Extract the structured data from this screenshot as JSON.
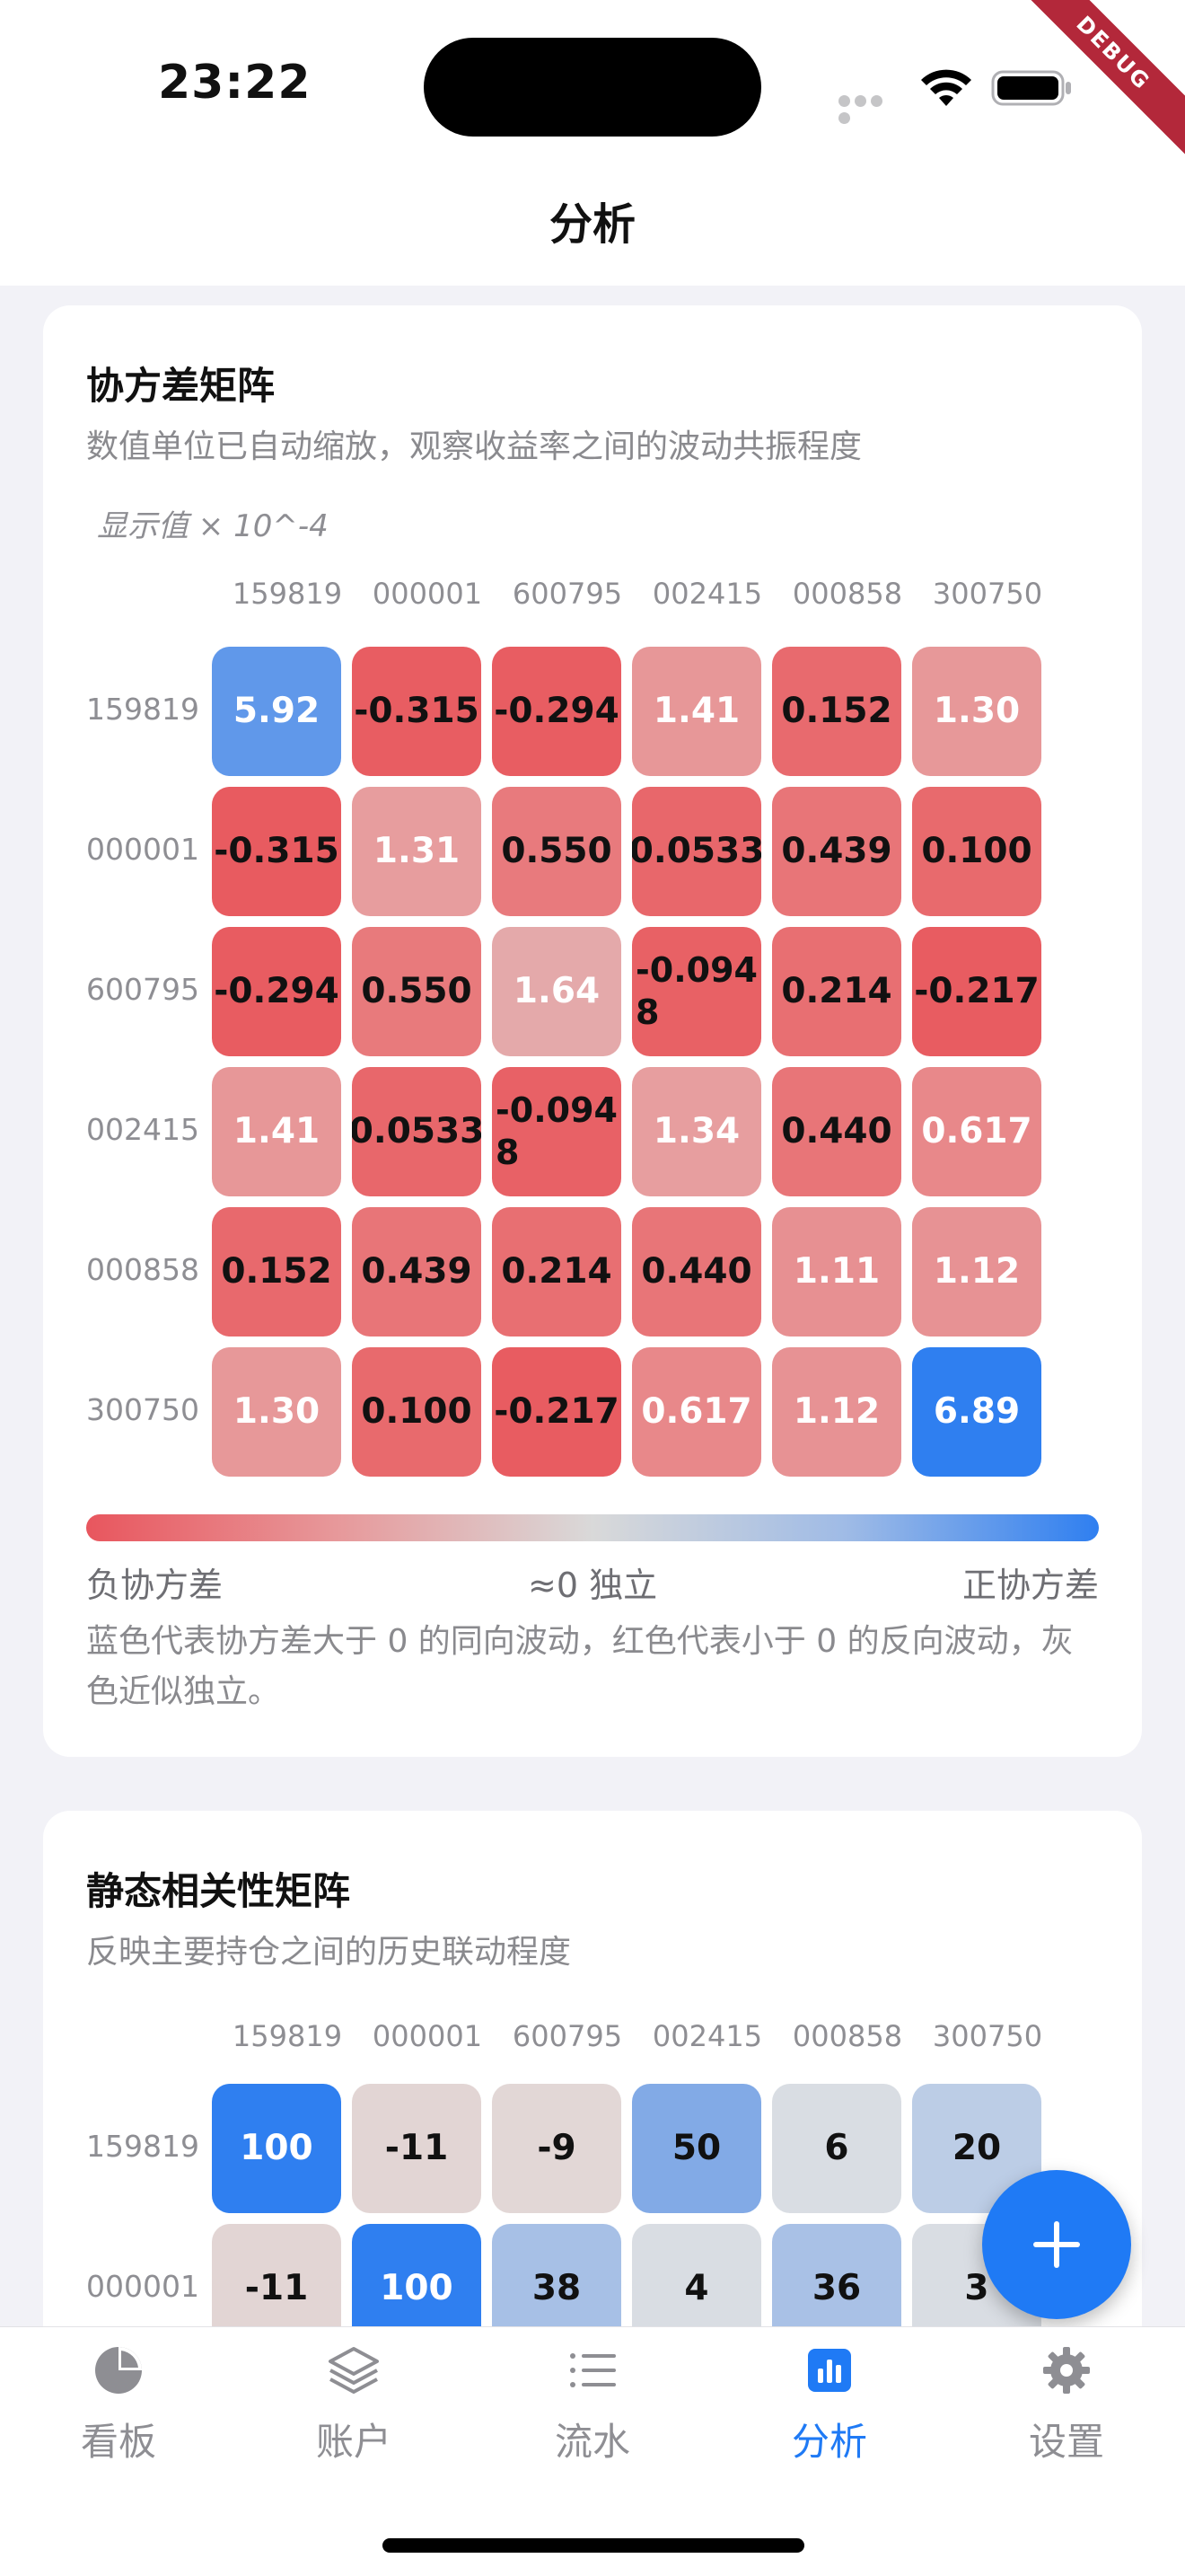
{
  "status_bar": {
    "time": "23:22",
    "debug_label": "DEBUG"
  },
  "nav": {
    "title": "分析"
  },
  "covariance_card": {
    "title": "协方差矩阵",
    "subtitle": "数值单位已自动缩放，观察收益率之间的波动共振程度",
    "scale_note": "显示值 × 10^-4",
    "tickers": [
      "159819",
      "000001",
      "600795",
      "002415",
      "000858",
      "300750"
    ],
    "cells": [
      [
        "5.92",
        "-0.315",
        "-0.294",
        "1.41",
        "0.152",
        "1.30"
      ],
      [
        "-0.315",
        "1.31",
        "0.550",
        "0.0533",
        "0.439",
        "0.100"
      ],
      [
        "-0.294",
        "0.550",
        "1.64",
        "-0.0948",
        "0.214",
        "-0.217"
      ],
      [
        "1.41",
        "0.0533",
        "-0.0948",
        "1.34",
        "0.440",
        "0.617"
      ],
      [
        "0.152",
        "0.439",
        "0.214",
        "0.440",
        "1.11",
        "1.12"
      ],
      [
        "1.30",
        "0.100",
        "-0.217",
        "0.617",
        "1.12",
        "6.89"
      ]
    ],
    "cell_colors": [
      [
        "#6098ea",
        "#e85d62",
        "#e85d62",
        "#e79798",
        "#e86a6e",
        "#e79899"
      ],
      [
        "#e85b60",
        "#e79d9e",
        "#e87a7d",
        "#e8676b",
        "#e87578",
        "#e86a6d"
      ],
      [
        "#e85c61",
        "#e87a7c",
        "#e4a9aa",
        "#e86165",
        "#e86f72",
        "#e85c61"
      ],
      [
        "#e79798",
        "#e8676b",
        "#e86166",
        "#e79e9f",
        "#e87578",
        "#e8888a"
      ],
      [
        "#e8696d",
        "#e87578",
        "#e86f72",
        "#e87578",
        "#e79092",
        "#e79294"
      ],
      [
        "#e79899",
        "#e86a6d",
        "#e85c61",
        "#e8888a",
        "#e79294",
        "#2f7ff0"
      ]
    ],
    "cell_text_light": [
      [
        true,
        false,
        false,
        true,
        false,
        true
      ],
      [
        false,
        true,
        false,
        false,
        false,
        false
      ],
      [
        false,
        false,
        true,
        false,
        false,
        false
      ],
      [
        true,
        false,
        false,
        true,
        false,
        true
      ],
      [
        false,
        false,
        false,
        false,
        true,
        true
      ],
      [
        true,
        false,
        false,
        true,
        true,
        true
      ]
    ],
    "legend": {
      "negative": "负协方差",
      "neutral": "≈0 独立",
      "positive": "正协方差",
      "note": "蓝色代表协方差大于 0 的同向波动，红色代表小于 0 的反向波动，灰色近似独立。"
    }
  },
  "correlation_card": {
    "title": "静态相关性矩阵",
    "subtitle": "反映主要持仓之间的历史联动程度",
    "tickers": [
      "159819",
      "000001",
      "600795",
      "002415",
      "000858",
      "300750"
    ],
    "cells": [
      [
        "100",
        "-11",
        "-9",
        "50",
        "6",
        "20"
      ],
      [
        "-11",
        "100",
        "38",
        "4",
        "36",
        "3"
      ]
    ],
    "cell_colors": [
      [
        "#2f7ff0",
        "#e2d5d4",
        "#e2d7d6",
        "#82aae6",
        "#d9dde3",
        "#bccde6"
      ],
      [
        "#e2d5d4",
        "#2f7ff0",
        "#a7c0e6",
        "#d9dde3",
        "#a9c1e6",
        "#d9dde3"
      ]
    ],
    "cell_text_light": [
      [
        true,
        false,
        false,
        false,
        false,
        false
      ],
      [
        false,
        true,
        false,
        false,
        false,
        false
      ]
    ]
  },
  "fab": {
    "icon": "plus-icon"
  },
  "tabs": [
    {
      "label": "看板",
      "icon": "pie-chart-icon",
      "active": false
    },
    {
      "label": "账户",
      "icon": "layers-icon",
      "active": false
    },
    {
      "label": "流水",
      "icon": "list-icon",
      "active": false
    },
    {
      "label": "分析",
      "icon": "bar-chart-icon",
      "active": true
    },
    {
      "label": "设置",
      "icon": "gear-icon",
      "active": false
    }
  ],
  "colors": {
    "accent": "#1f7af5",
    "negative": "#e8565e",
    "neutral": "#d9d9d9",
    "positive": "#2f7ff0"
  }
}
